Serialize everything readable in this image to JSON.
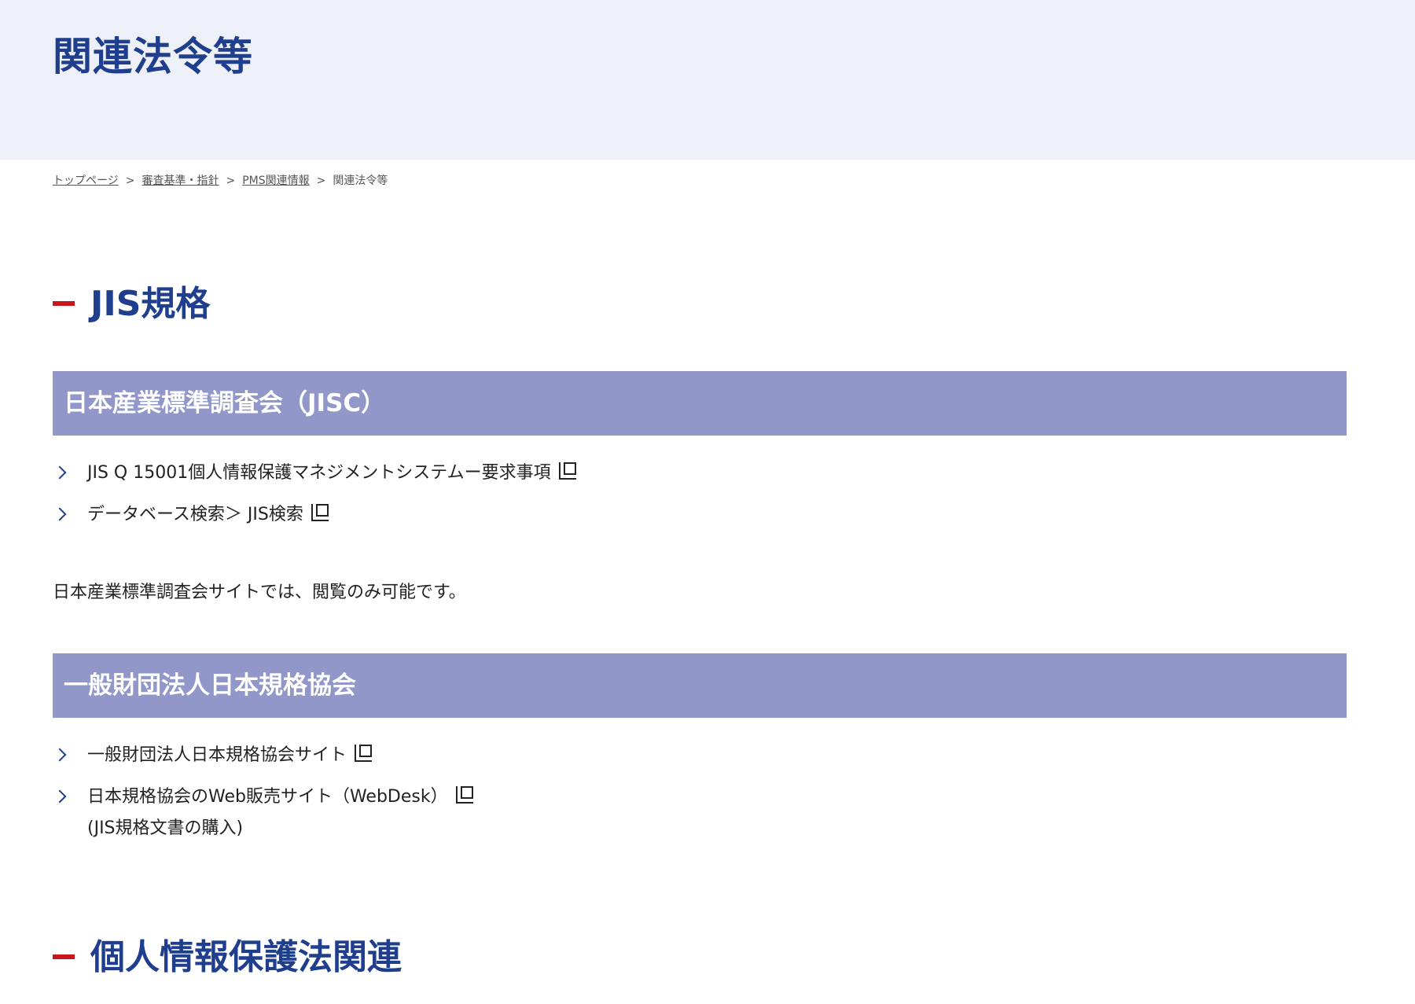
{
  "header": {
    "title": "関連法令等"
  },
  "breadcrumb": {
    "items": [
      "トップページ",
      "審査基準・指針",
      "PMS関連情報"
    ],
    "current": "関連法令等",
    "separator": ">"
  },
  "sections": [
    {
      "heading": "JIS規格",
      "subsections": [
        {
          "heading": "日本産業標準調査会（JISC）",
          "links": [
            "JIS Q 15001個人情報保護マネジメントシステムー要求事項",
            "データベース検索＞ JIS検索"
          ],
          "note": "日本産業標準調査会サイトでは、閲覧のみ可能です。"
        },
        {
          "heading": "一般財団法人日本規格協会",
          "links": [
            "一般財団法人日本規格協会サイト",
            "日本規格協会のWeb販売サイト（WebDesk）"
          ],
          "link_sub": "(JIS規格文書の購入)"
        }
      ]
    },
    {
      "heading": "個人情報保護法関連"
    }
  ],
  "colors": {
    "accent": "#1f3e8e",
    "dash": "#c8161d",
    "subheading_bg": "#9197c8",
    "header_bg": "#edf0f7"
  }
}
